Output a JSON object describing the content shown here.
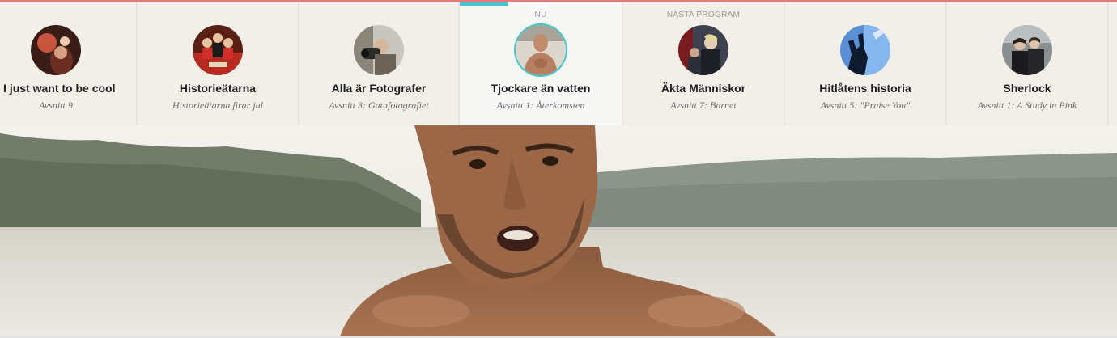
{
  "schedule": {
    "items": [
      {
        "title": "- I just want to be cool",
        "subtitle": "Avsnitt 9",
        "label": "",
        "thumb_icon": "show-thumbnail-icon"
      },
      {
        "title": "Historieätarna",
        "subtitle": "Historieätarna firar jul",
        "label": "",
        "thumb_icon": "show-thumbnail-icon"
      },
      {
        "title": "Alla är Fotografer",
        "subtitle": "Avsnitt 3: Gatufotografiet",
        "label": "",
        "thumb_icon": "show-thumbnail-icon"
      },
      {
        "title": "Tjockare än vatten",
        "subtitle": "Avsnitt 1: Återkomsten",
        "label": "NU",
        "thumb_icon": "show-thumbnail-icon"
      },
      {
        "title": "Äkta Människor",
        "subtitle": "Avsnitt 7: Barnet",
        "label": "NÄSTA PROGRAM",
        "thumb_icon": "show-thumbnail-icon"
      },
      {
        "title": "Hitlåtens historia",
        "subtitle": "Avsnitt 5: \"Praise You\"",
        "label": "",
        "thumb_icon": "show-thumbnail-icon"
      },
      {
        "title": "Sherlock",
        "subtitle": "Avsnitt 1: A Study in Pink",
        "label": "",
        "thumb_icon": "show-thumbnail-icon"
      }
    ]
  },
  "colors": {
    "accent": "#43c5c9",
    "top_line": "#e97a73",
    "strip_bg": "#f1efe8",
    "active_bg": "#f7f7f5"
  }
}
